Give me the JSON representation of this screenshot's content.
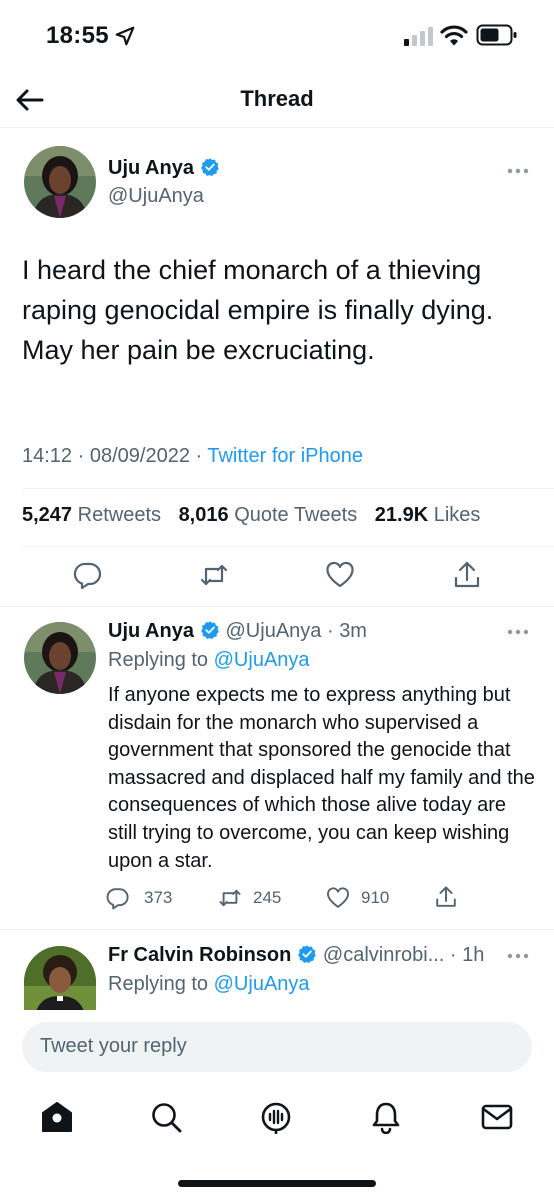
{
  "status_bar": {
    "time": "18:55"
  },
  "header": {
    "title": "Thread"
  },
  "main_tweet": {
    "name": "Uju Anya",
    "handle": "@UjuAnya",
    "text": "I heard the chief monarch of a thieving raping genocidal empire is finally dying. May her pain be excruciating.",
    "time": "14:12",
    "date": "08/09/2022",
    "source": "Twitter for iPhone",
    "retweets": "5,247",
    "retweets_label": "Retweets",
    "quotes": "8,016",
    "quotes_label": "Quote Tweets",
    "likes": "21.9K",
    "likes_label": "Likes"
  },
  "reply1": {
    "name": "Uju Anya",
    "handle": "@UjuAnya",
    "age": "3m",
    "replying_label": "Replying to",
    "replying_to": "@UjuAnya",
    "text": "If anyone expects me to express anything but disdain for the monarch who supervised a government that sponsored the genocide that massacred and displaced half my family and the consequences of which those alive today are still trying to overcome, you can keep wishing upon a star.",
    "replies": "373",
    "retweets": "245",
    "likes": "910"
  },
  "reply2": {
    "name": "Fr Calvin Robinson",
    "handle": "@calvinrobi...",
    "age": "1h",
    "replying_label": "Replying to",
    "replying_to": "@UjuAnya"
  },
  "reply_input": {
    "placeholder": "Tweet your reply"
  },
  "colors": {
    "accent": "#1d9bf0",
    "text": "#0f1419",
    "muted": "#536471"
  },
  "icons": {
    "nav": [
      "home-icon",
      "search-icon",
      "spaces-icon",
      "notifications-icon",
      "messages-icon"
    ],
    "actions": [
      "reply-icon",
      "retweet-icon",
      "like-icon",
      "share-icon"
    ]
  }
}
